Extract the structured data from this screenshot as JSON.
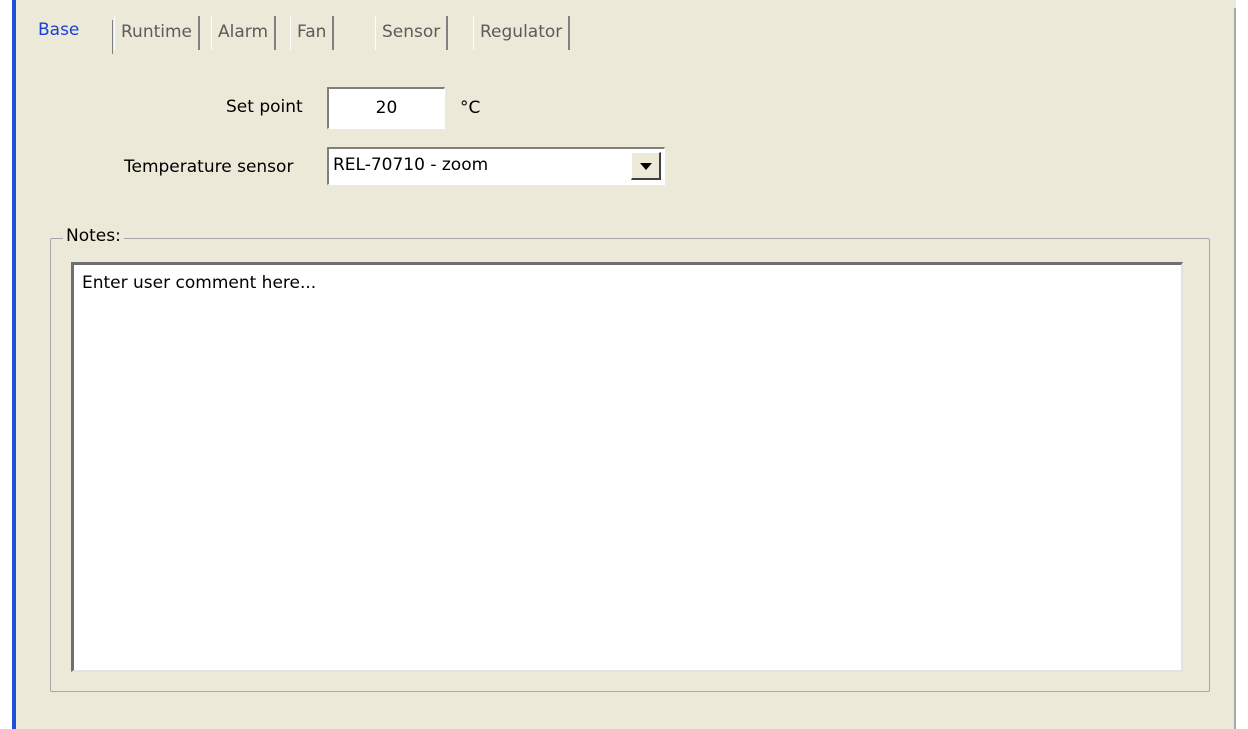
{
  "tabs": [
    {
      "label": "Base",
      "active": true
    },
    {
      "label": "Runtime",
      "active": false
    },
    {
      "label": "Alarm",
      "active": false
    },
    {
      "label": "Fan",
      "active": false
    },
    {
      "label": "Sensor",
      "active": false
    },
    {
      "label": "Regulator",
      "active": false
    }
  ],
  "form": {
    "setpoint_label": "Set point",
    "setpoint_value": "20",
    "setpoint_unit": "°C",
    "sensor_label": "Temperature sensor",
    "sensor_selected": "REL-70710 - zoom"
  },
  "notes": {
    "legend": "Notes:",
    "text": "Enter user comment here..."
  },
  "colors": {
    "background": "#ECE9D8",
    "active_tab": "#1A3FD8",
    "edge_accent": "#1E4FD8"
  }
}
